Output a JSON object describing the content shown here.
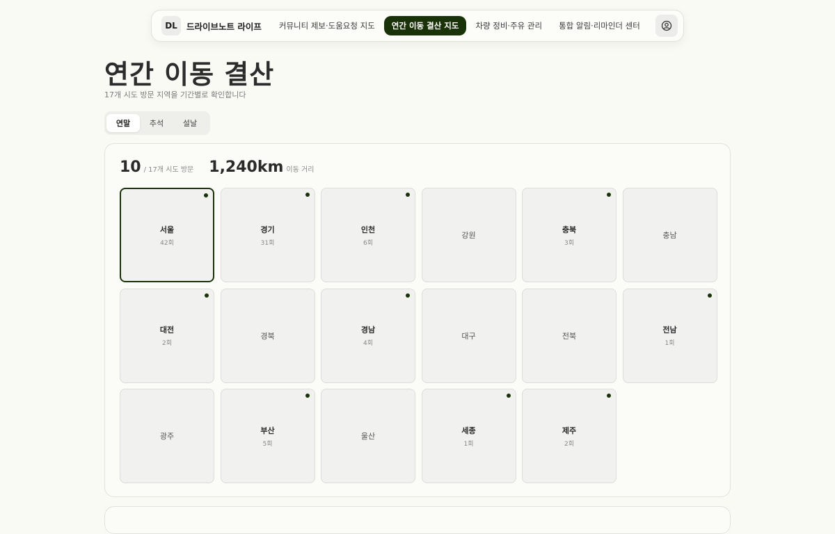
{
  "nav": {
    "logo": "DL",
    "brand": "드라이브노트 라이프",
    "links": [
      {
        "label": "커뮤니티 제보·도움요청 지도",
        "active": false
      },
      {
        "label": "연간 이동 결산 지도",
        "active": true
      },
      {
        "label": "차량 정비·주유 관리",
        "active": false
      },
      {
        "label": "통합 알림·리마인더 센터",
        "active": false
      }
    ],
    "profile_icon": "user-circle-icon"
  },
  "page": {
    "title": "연간 이동 결산",
    "subtitle": "17개 시도 방문 지역을 기간별로 확인합니다"
  },
  "tabs": [
    {
      "label": "연말",
      "active": true
    },
    {
      "label": "추석",
      "active": false
    },
    {
      "label": "설날",
      "active": false
    }
  ],
  "stats": {
    "visited": "10",
    "visited_label": "/ 17개 시도 방문",
    "distance": "1,240km",
    "distance_label": "이동 거리"
  },
  "regions": [
    {
      "name": "서울",
      "count": "42회",
      "visited": true,
      "selected": true
    },
    {
      "name": "경기",
      "count": "31회",
      "visited": true
    },
    {
      "name": "인천",
      "count": "6회",
      "visited": true
    },
    {
      "name": "강원",
      "count": "",
      "visited": false
    },
    {
      "name": "충북",
      "count": "3회",
      "visited": true
    },
    {
      "name": "충남",
      "count": "",
      "visited": false
    },
    {
      "name": "대전",
      "count": "2회",
      "visited": true
    },
    {
      "name": "경북",
      "count": "",
      "visited": false
    },
    {
      "name": "경남",
      "count": "4회",
      "visited": true
    },
    {
      "name": "대구",
      "count": "",
      "visited": false
    },
    {
      "name": "전북",
      "count": "",
      "visited": false
    },
    {
      "name": "전남",
      "count": "1회",
      "visited": true
    },
    {
      "name": "광주",
      "count": "",
      "visited": false
    },
    {
      "name": "부산",
      "count": "5회",
      "visited": true
    },
    {
      "name": "울산",
      "count": "",
      "visited": false
    },
    {
      "name": "세종",
      "count": "1회",
      "visited": true
    },
    {
      "name": "제주",
      "count": "2회",
      "visited": true
    }
  ],
  "colors": {
    "accent": "#1a3208",
    "background": "#fafaf5",
    "cell": "#f1f1f0"
  }
}
